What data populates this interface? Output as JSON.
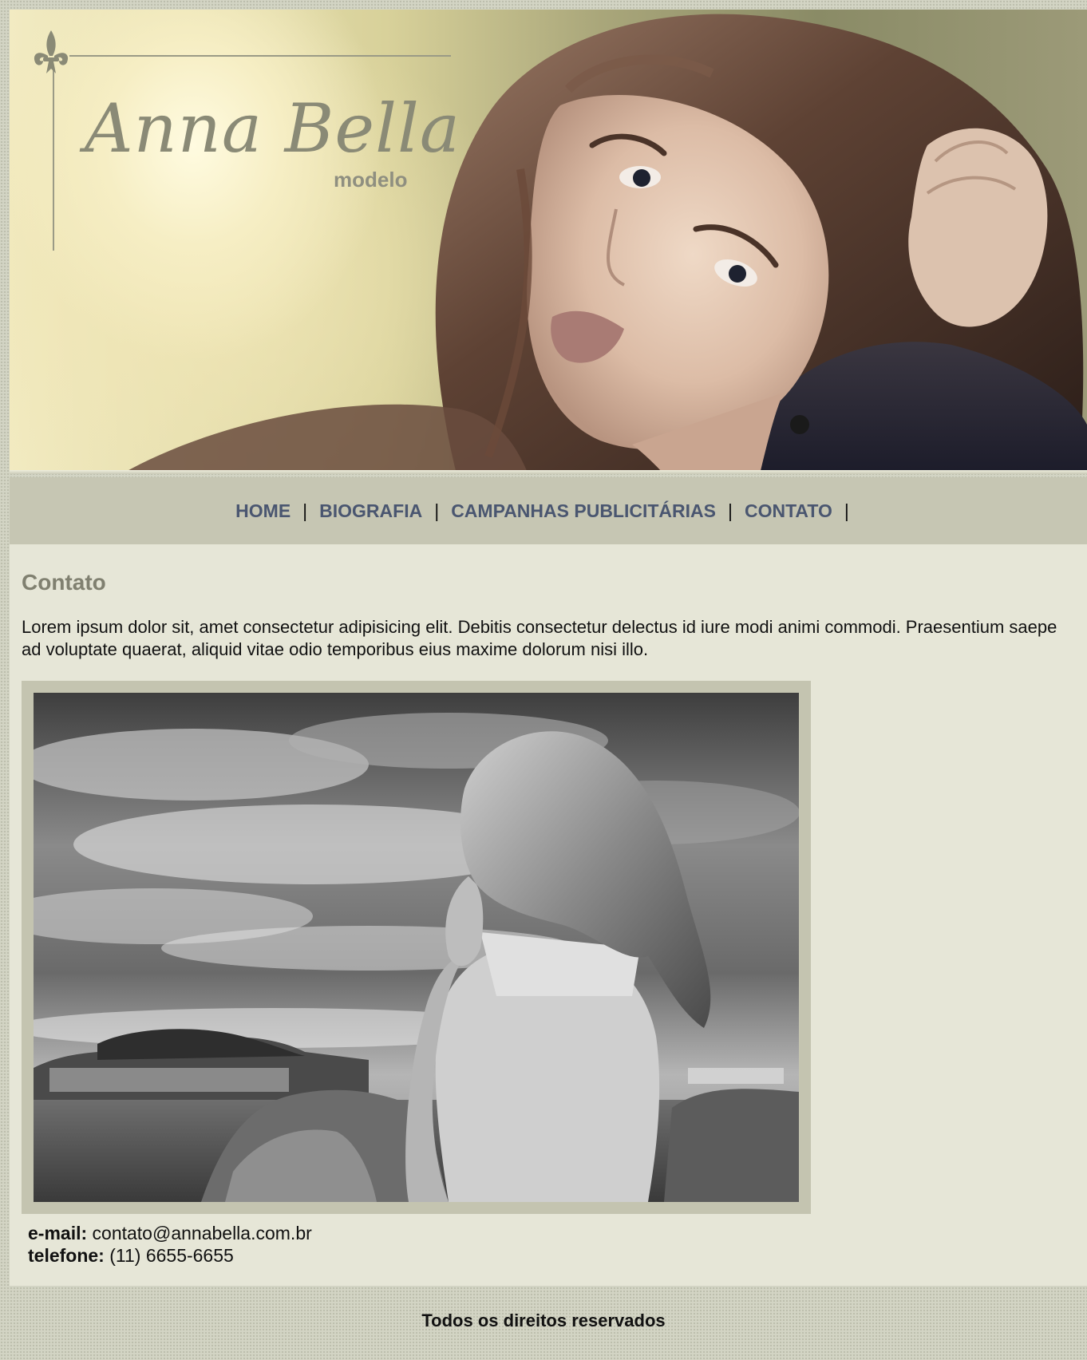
{
  "brand": {
    "name": "Anna Bella",
    "subtitle": "modelo"
  },
  "nav": {
    "items": [
      {
        "label": "HOME"
      },
      {
        "label": "BIOGRAFIA"
      },
      {
        "label": "CAMPANHAS PUBLICITÁRIAS"
      },
      {
        "label": "CONTATO"
      }
    ],
    "separator": "|"
  },
  "page": {
    "title": "Contato",
    "intro": "Lorem ipsum dolor sit, amet consectetur adipisicing elit. Debitis consectetur delectus id iure modi animi commodi. Praesentium saepe ad voluptate quaerat, aliquid vitae odio temporibus eius maxime dolorum nisi illo."
  },
  "contact": {
    "email_label": "e-mail:",
    "email": "contato@annabella.com.br",
    "phone_label": "telefone:",
    "phone": "(11) 6655-6655"
  },
  "footer": {
    "text": "Todos os direitos reservados"
  },
  "colors": {
    "page_bg": "#d3d4c4",
    "nav_bg": "#c6c6b3",
    "nav_link": "#4a5670",
    "content_bg": "#e6e6d7",
    "heading": "#808070",
    "frame": "#c4c4b0"
  }
}
